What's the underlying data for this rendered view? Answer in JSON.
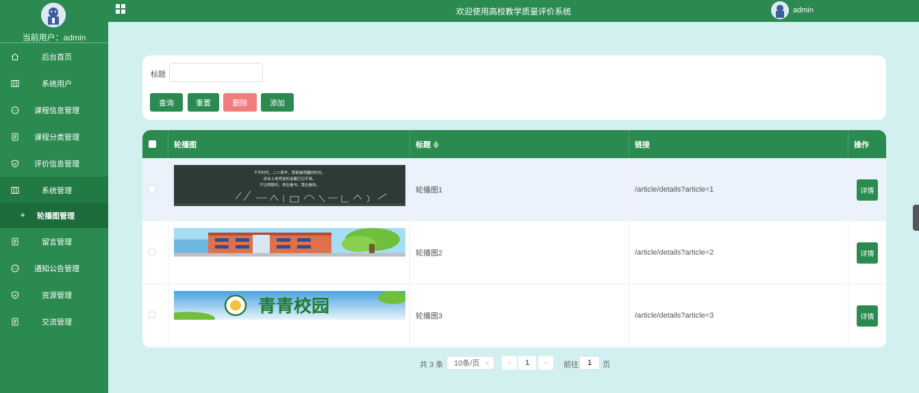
{
  "sidebar": {
    "current_user": "当前用户：admin",
    "items": [
      {
        "label": "后台首页",
        "icon": "home-icon"
      },
      {
        "label": "系统用户",
        "icon": "columns-icon"
      },
      {
        "label": "课程信息管理",
        "icon": "chat-icon"
      },
      {
        "label": "课程分类管理",
        "icon": "document-icon"
      },
      {
        "label": "评价信息管理",
        "icon": "shield-check-icon"
      },
      {
        "label": "系统管理",
        "icon": "columns-icon"
      },
      {
        "label": "留言管理",
        "icon": "document-icon"
      },
      {
        "label": "通知公告管理",
        "icon": "chat-icon"
      },
      {
        "label": "资源管理",
        "icon": "shield-check-icon"
      },
      {
        "label": "交流管理",
        "icon": "document-icon"
      }
    ],
    "sub_item": {
      "label": "轮播图管理",
      "prefix": "+"
    }
  },
  "topbar": {
    "title": "欢迎使用高校教学质量评价系统",
    "username": "admin"
  },
  "search": {
    "label": "标题",
    "value": "",
    "buttons": {
      "query": "查询",
      "reset": "重置",
      "delete": "删除",
      "add": "添加"
    }
  },
  "table": {
    "headers": {
      "image": "轮播图",
      "title": "标题 ≑",
      "link": "链接",
      "action": "操作"
    },
    "rows": [
      {
        "title": "轮播图1",
        "link": "/article/details?article=1",
        "action": "详情"
      },
      {
        "title": "轮播图2",
        "link": "/article/details?article=2",
        "action": "详情"
      },
      {
        "title": "轮播图3",
        "link": "/article/details?article=3",
        "action": "详情"
      }
    ],
    "banner1_lines": [
      "千年时代，二八青华，那是最明媚的时光。",
      "讲台上老师说的话都已记不清，",
      "只记得那时，你在看书，我在看你。"
    ],
    "banner3_text": "青青校园"
  },
  "pagination": {
    "total": "共 3 条",
    "page_size": "10条/页",
    "current_page": "1",
    "goto_label": "前往",
    "goto_value": "1",
    "page_suffix": "页"
  },
  "colors": {
    "primary": "#2a8a4f",
    "danger": "#f07c7c",
    "background": "#d3f0f0"
  }
}
